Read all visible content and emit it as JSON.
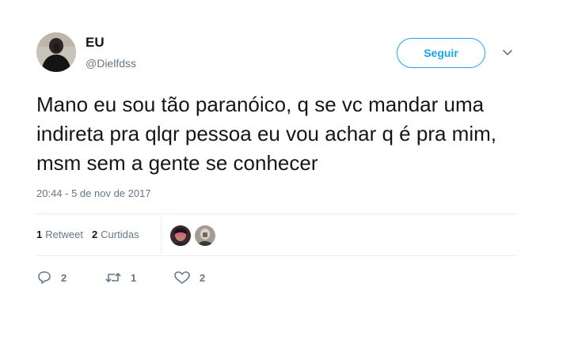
{
  "user": {
    "name": "EU",
    "handle": "@Dielfdss"
  },
  "follow_label": "Seguir",
  "tweet": {
    "text": "Mano eu sou tão paranóico, q se vc mandar uma indireta pra qlqr pessoa eu vou achar q é pra mim, msm sem a gente se conhecer",
    "timestamp": "20:44 - 5 de nov de 2017"
  },
  "stats": {
    "retweets_count": "1",
    "retweets_label": "Retweet",
    "likes_count": "2",
    "likes_label": "Curtidas"
  },
  "actions": {
    "reply_count": "2",
    "retweet_count": "1",
    "like_count": "2"
  },
  "colors": {
    "accent": "#1da1f2",
    "secondary_text": "#657786",
    "primary_text": "#14171a",
    "divider": "#e6ecf0"
  },
  "icons": [
    "reply-icon",
    "retweet-icon",
    "heart-icon",
    "chevron-down-icon"
  ]
}
